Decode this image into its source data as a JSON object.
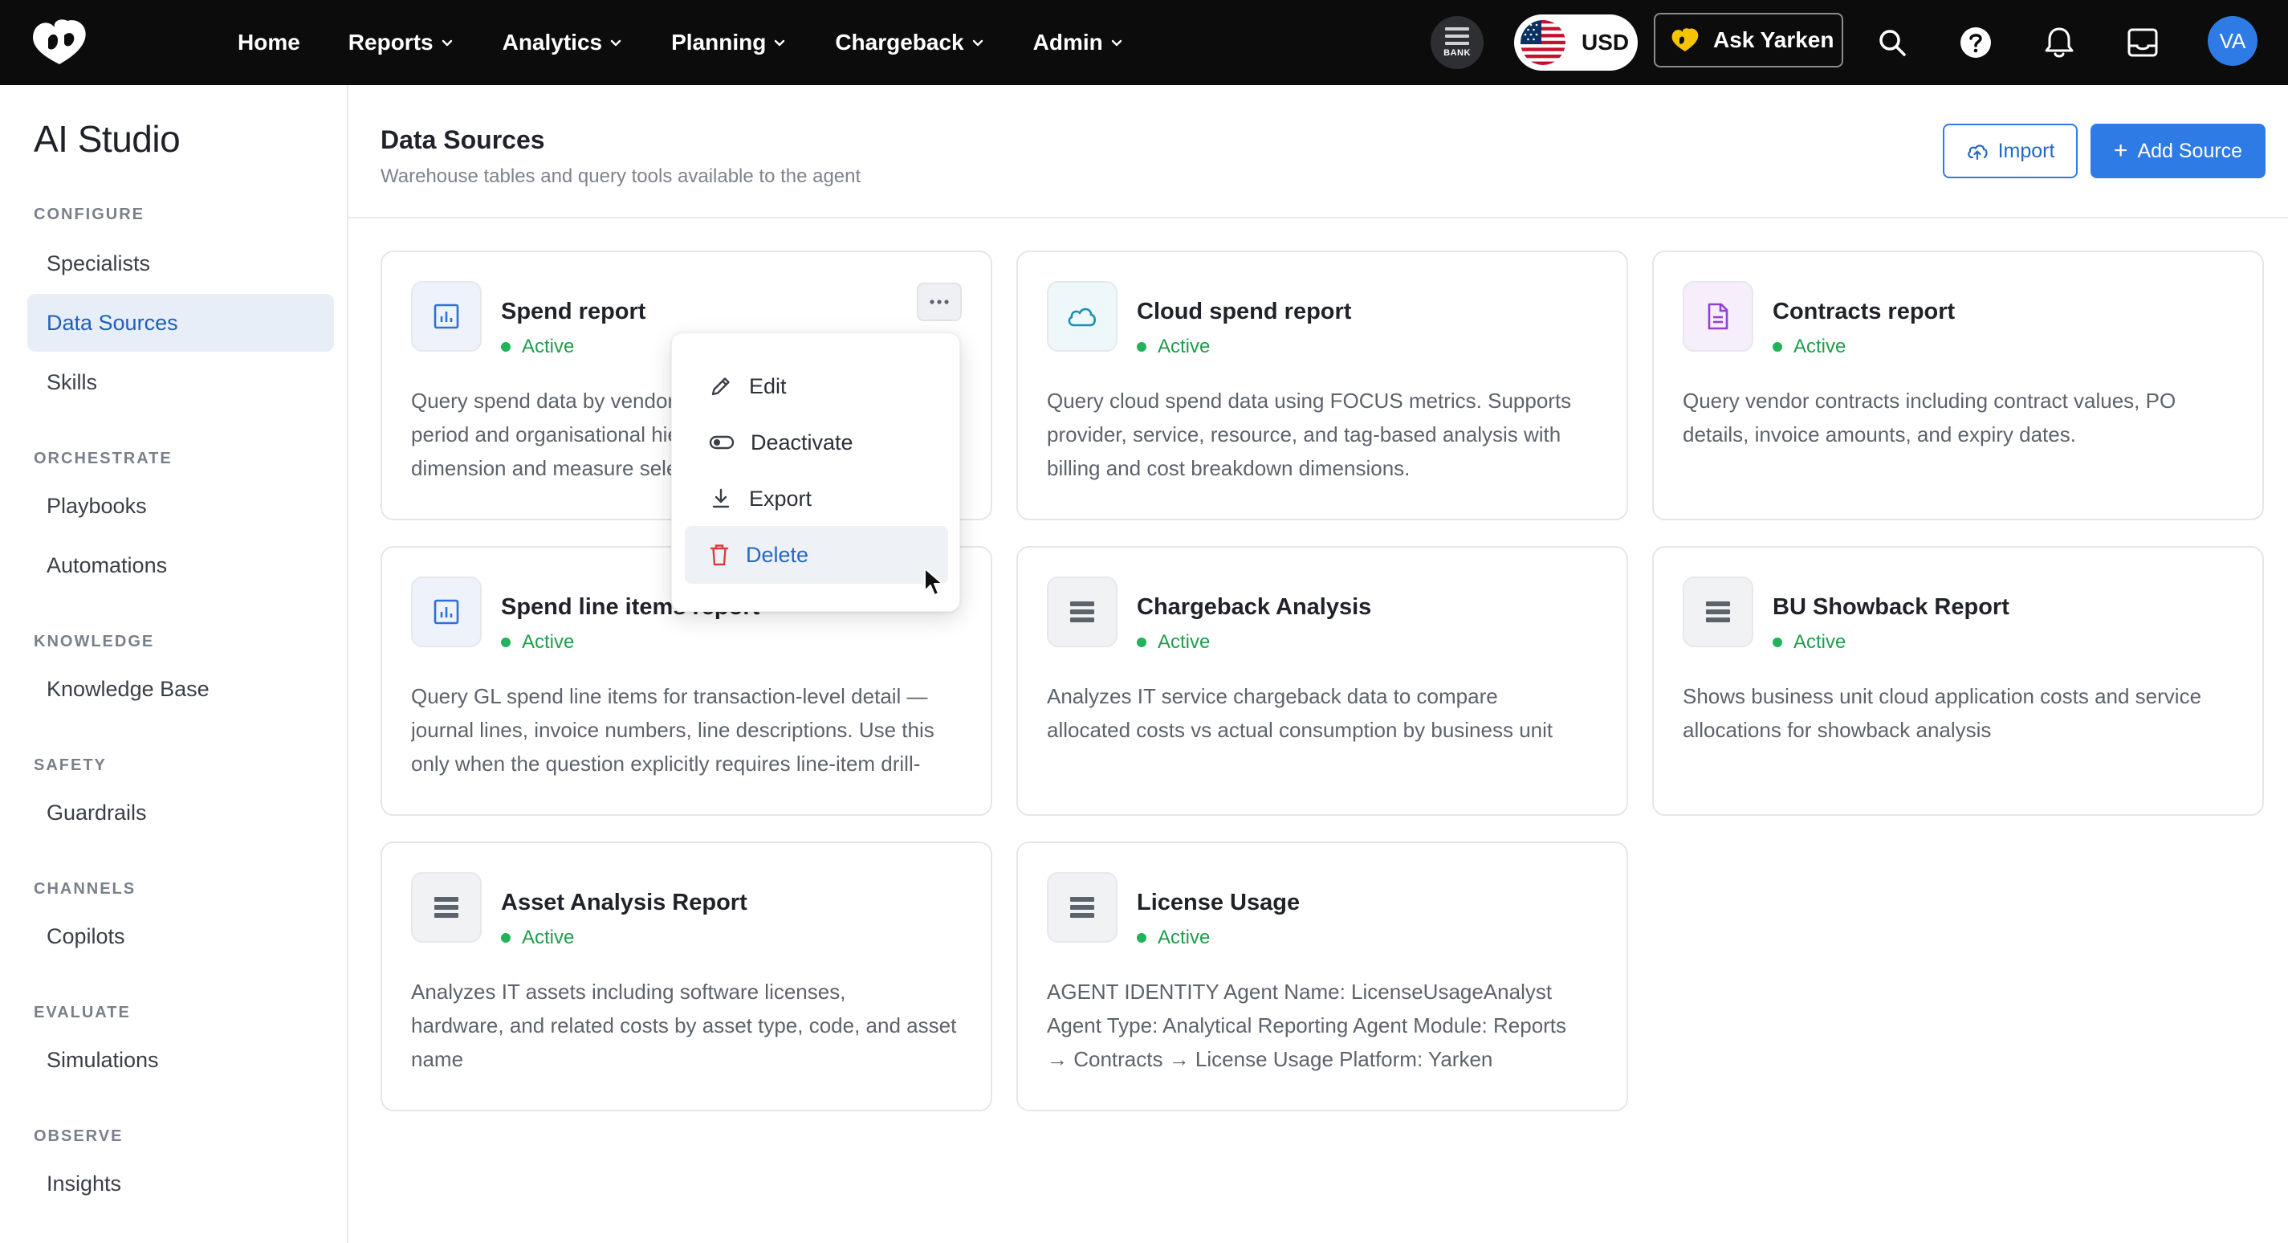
{
  "topnav": {
    "items": [
      {
        "label": "Home",
        "has_menu": false
      },
      {
        "label": "Reports",
        "has_menu": true
      },
      {
        "label": "Analytics",
        "has_menu": true
      },
      {
        "label": "Planning",
        "has_menu": true
      },
      {
        "label": "Chargeback",
        "has_menu": true
      },
      {
        "label": "Admin",
        "has_menu": true
      }
    ],
    "bank_label": "BANK",
    "currency": "USD",
    "ask_label": "Ask Yarken",
    "avatar_initials": "VA",
    "icons": [
      "search-icon",
      "help-icon",
      "bell-icon",
      "inbox-icon"
    ]
  },
  "sidebar": {
    "title": "AI Studio",
    "sections": {
      "configure": "CONFIGURE",
      "orchestrate": "ORCHESTRATE",
      "knowledge": "KNOWLEDGE",
      "safety": "SAFETY",
      "channels": "CHANNELS",
      "evaluate": "EVALUATE",
      "observe": "OBSERVE"
    },
    "items": {
      "specialists": "Specialists",
      "data_sources": "Data Sources",
      "skills": "Skills",
      "playbooks": "Playbooks",
      "automations": "Automations",
      "knowledge_base": "Knowledge Base",
      "guardrails": "Guardrails",
      "copilots": "Copilots",
      "simulations": "Simulations",
      "insights": "Insights"
    },
    "active": "Data Sources"
  },
  "header": {
    "title": "Data Sources",
    "subtitle": "Warehouse tables and query tools available to the agent",
    "import_label": "Import",
    "add_label": "Add Source"
  },
  "cards": [
    {
      "title": "Spend report",
      "status": "Active",
      "icon": "chart-icon",
      "desc": [
        "Query spend data by vendor, category, cost centre, time",
        "period and organisational hierarchy with flexible",
        "dimension and measure selection"
      ]
    },
    {
      "title": "Cloud spend report",
      "status": "Active",
      "icon": "cloud-icon",
      "desc": [
        "Query cloud spend data using FOCUS metrics. Supports",
        "provider, service, resource, and tag-based analysis with",
        "billing and cost breakdown dimensions."
      ]
    },
    {
      "title": "Contracts report",
      "status": "Active",
      "icon": "document-icon",
      "desc": [
        "Query vendor contracts including contract values, PO",
        "details, invoice amounts, and expiry dates."
      ]
    },
    {
      "title": "Spend line items report",
      "status": "Active",
      "icon": "chart-icon",
      "desc": [
        "Query GL spend line items for transaction-level detail —",
        "journal lines, invoice numbers, line descriptions. Use this",
        "only when the question explicitly requires line-item drill-"
      ]
    },
    {
      "title": "Chargeback Analysis",
      "status": "Active",
      "icon": "table-icon",
      "desc": [
        "Analyzes IT service chargeback data to compare",
        "allocated costs vs actual consumption by business unit"
      ]
    },
    {
      "title": "BU Showback Report",
      "status": "Active",
      "icon": "table-icon",
      "desc": [
        "Shows business unit cloud application costs and service",
        "allocations for showback analysis"
      ]
    },
    {
      "title": "Asset Analysis Report",
      "status": "Active",
      "icon": "table-icon",
      "desc": [
        "Analyzes IT assets including software licenses,",
        "hardware, and related costs by asset type, code, and asset",
        "name"
      ]
    },
    {
      "title": "License Usage",
      "status": "Active",
      "icon": "table-icon",
      "desc": [
        "AGENT IDENTITY Agent Name: LicenseUsageAnalyst",
        "Agent Type: Analytical Reporting Agent Module: Reports",
        "→ Contracts → License Usage Platform: Yarken"
      ]
    }
  ],
  "menu": {
    "items": [
      {
        "label": "Edit",
        "icon": "pencil-icon"
      },
      {
        "label": "Deactivate",
        "icon": "toggle-icon"
      },
      {
        "label": "Export",
        "icon": "download-icon"
      },
      {
        "label": "Delete",
        "icon": "trash-icon"
      }
    ]
  },
  "colors": {
    "accent": "#2e7be6",
    "active_green": "#22b35a",
    "danger": "#e03b3b",
    "topbar": "#0c0c0c",
    "brand_yellow": "#f5c400"
  }
}
